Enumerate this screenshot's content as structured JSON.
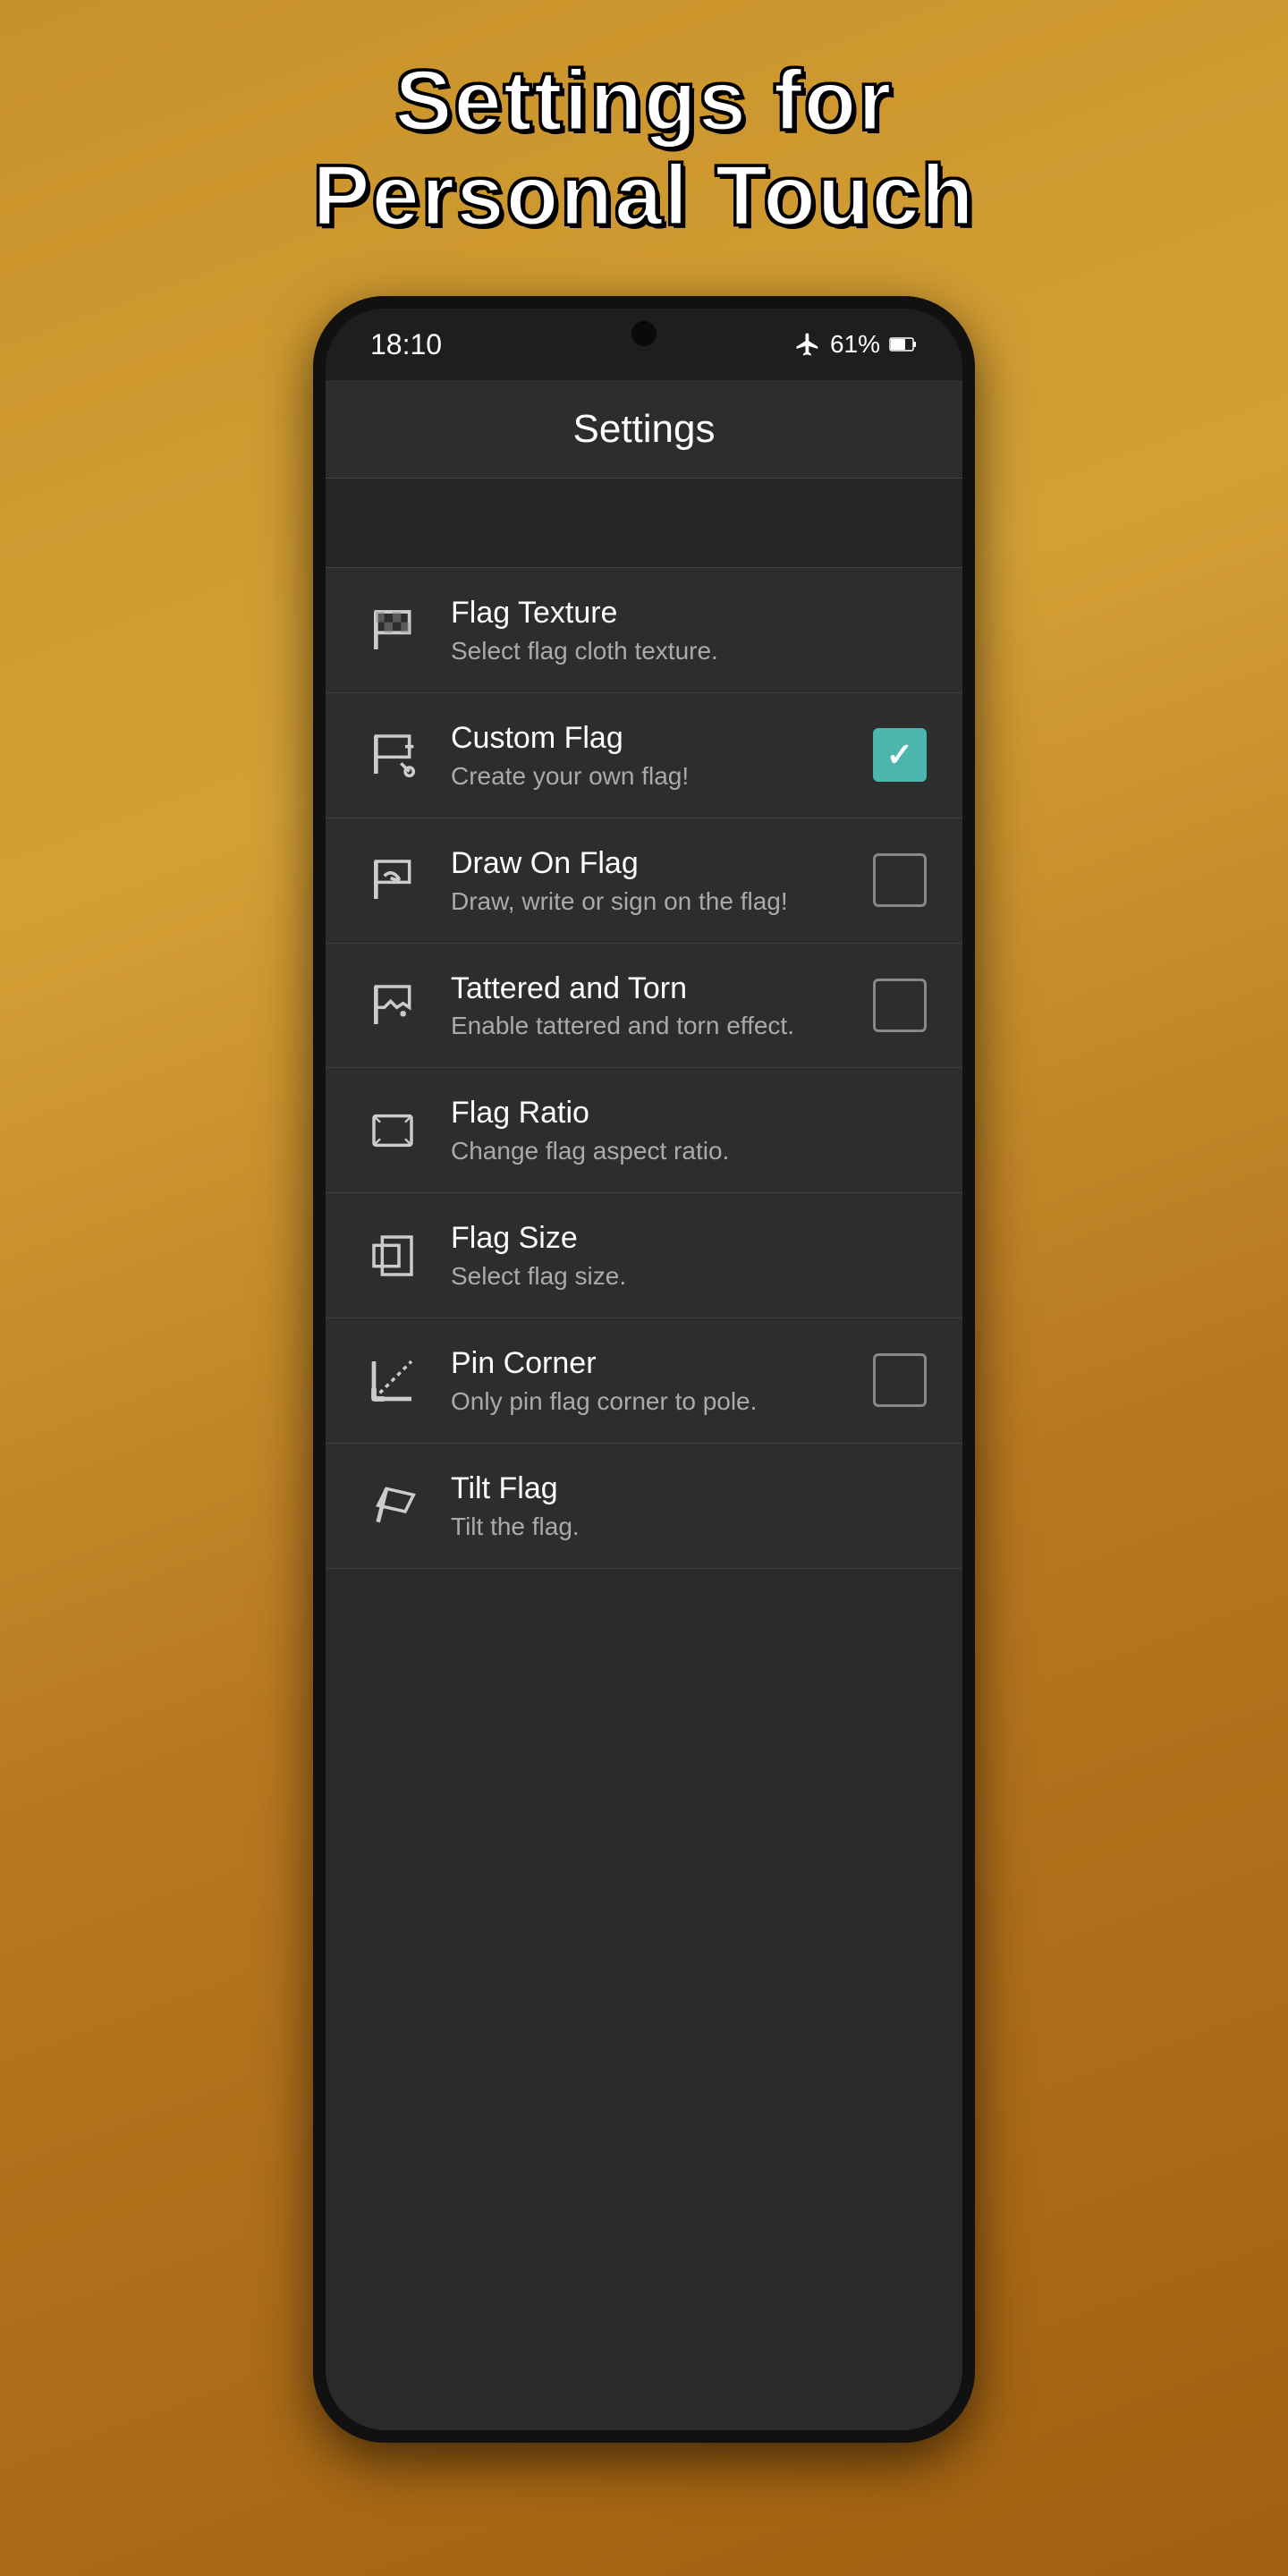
{
  "header": {
    "line1": "Settings for",
    "line2": "Personal Touch"
  },
  "statusBar": {
    "time": "18:10",
    "battery": "61%"
  },
  "appBar": {
    "title": "Settings"
  },
  "settings": {
    "items": [
      {
        "id": "flag-texture",
        "title": "Flag Texture",
        "subtitle": "Select flag cloth texture.",
        "hasCheckbox": false,
        "checked": false
      },
      {
        "id": "custom-flag",
        "title": "Custom Flag",
        "subtitle": "Create your own flag!",
        "hasCheckbox": true,
        "checked": true
      },
      {
        "id": "draw-on-flag",
        "title": "Draw On Flag",
        "subtitle": "Draw, write or sign on the flag!",
        "hasCheckbox": true,
        "checked": false
      },
      {
        "id": "tattered-torn",
        "title": "Tattered and Torn",
        "subtitle": "Enable tattered and torn effect.",
        "hasCheckbox": true,
        "checked": false
      },
      {
        "id": "flag-ratio",
        "title": "Flag Ratio",
        "subtitle": "Change flag aspect ratio.",
        "hasCheckbox": false,
        "checked": false
      },
      {
        "id": "flag-size",
        "title": "Flag Size",
        "subtitle": "Select flag size.",
        "hasCheckbox": false,
        "checked": false
      },
      {
        "id": "pin-corner",
        "title": "Pin Corner",
        "subtitle": "Only pin flag corner to pole.",
        "hasCheckbox": true,
        "checked": false
      },
      {
        "id": "tilt-flag",
        "title": "Tilt Flag",
        "subtitle": "Tilt the flag.",
        "hasCheckbox": false,
        "checked": false
      }
    ]
  }
}
